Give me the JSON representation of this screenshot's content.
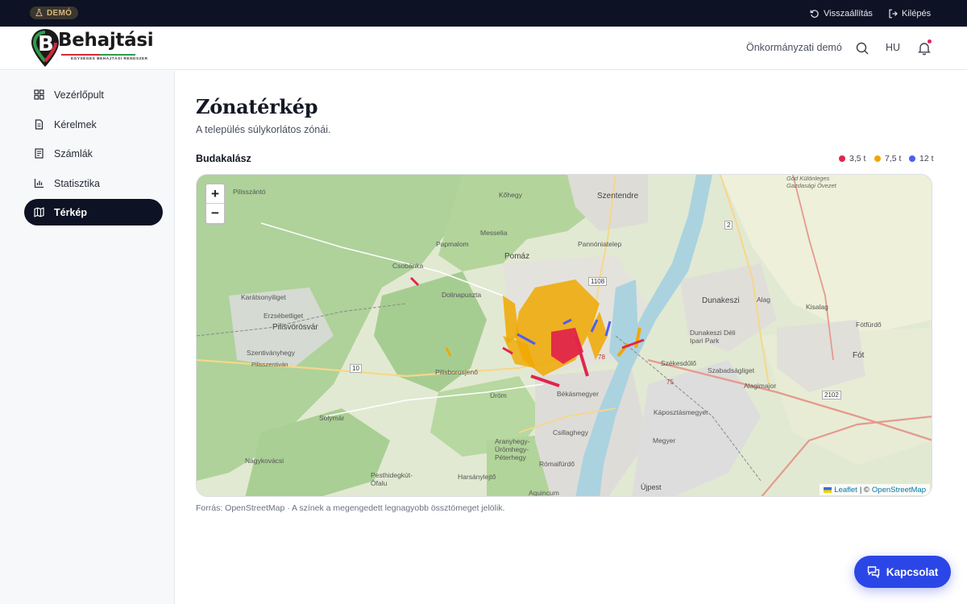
{
  "topbar": {
    "demo_badge": "DEMÓ",
    "restore_label": "Visszaállítás",
    "logout_label": "Kilépés"
  },
  "header": {
    "logo_title": "Behajtási",
    "logo_subtitle": "EGYSÉGES BEHAJTÁSI RENDSZER",
    "tenant": "Önkormányzati demó",
    "language": "HU"
  },
  "sidebar": {
    "items": [
      {
        "label": "Vezérlőpult",
        "icon": "dashboard-icon"
      },
      {
        "label": "Kérelmek",
        "icon": "document-icon"
      },
      {
        "label": "Számlák",
        "icon": "invoice-icon"
      },
      {
        "label": "Statisztika",
        "icon": "chart-icon"
      },
      {
        "label": "Térkép",
        "icon": "map-icon",
        "active": true
      }
    ]
  },
  "main": {
    "title": "Zónatérkép",
    "subtitle": "A település súlykorlátos zónái.",
    "city": "Budakalász",
    "legend": [
      {
        "label": "3,5 t",
        "color": "#e0264b"
      },
      {
        "label": "7,5 t",
        "color": "#f0a800"
      },
      {
        "label": "12 t",
        "color": "#4f5ef0"
      }
    ],
    "map": {
      "zoom_in": "+",
      "zoom_out": "−",
      "attribution_leaflet": "Leaflet",
      "attribution_sep": "| ©",
      "attribution_osm": "OpenStreetMap",
      "place_labels": [
        "Pilisszántó",
        "Kőhegy",
        "Szentendre",
        "Papmalom",
        "Messelia",
        "Pannóniatelep",
        "Pomáz",
        "Csobánka",
        "Karátsonyiliget",
        "Dolinapuszta",
        "Erzsébetliget",
        "Pilisvörösvár",
        "Szentiványhegy",
        "Pilisszentiván",
        "Pilisborosjenő",
        "Üröm",
        "Békásmegyer",
        "Solymár",
        "Csillaghegy",
        "Aranyhegy-Ürömhegy-Péterhegy",
        "Nagykovácsi",
        "Pesthidegkút-Ófalu",
        "Harsánylejtő",
        "Rómaifürdő",
        "Aquincum",
        "Újpest",
        "Dunakeszi",
        "Alag",
        "Kisalag",
        "Fótfürdő",
        "Fót",
        "Dunakeszi Déli Ipari Park",
        "Székesdűlő",
        "Szabadságliget",
        "Alagimajor",
        "Káposztásmegyer",
        "Megyer",
        "Göd Különleges Gazdasági Övezet",
        "1108",
        "10",
        "2",
        "2102",
        "75",
        "78"
      ]
    },
    "footnote": "Forrás: OpenStreetMap · A színek a megengedett legnagyobb össztömeget jelölik."
  },
  "contact_label": "Kapcsolat"
}
